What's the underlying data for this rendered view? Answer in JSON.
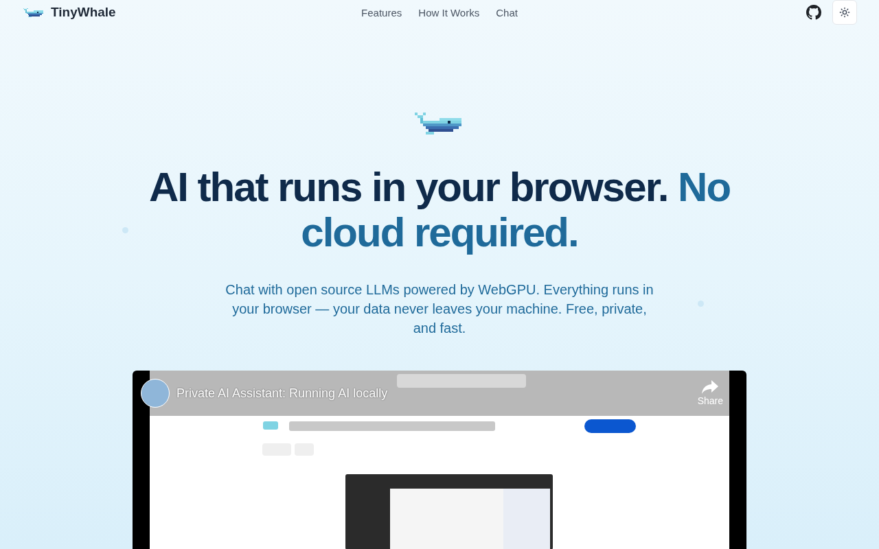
{
  "brand": {
    "name": "TinyWhale"
  },
  "nav": [
    "Features",
    "How It Works",
    "Chat"
  ],
  "hero": {
    "headline": "AI that runs in your browser.",
    "headline_accent": "No cloud required.",
    "subtitle": "Chat with open source LLMs powered by WebGPU. Everything runs in your browser — your data never leaves your machine. Free, private, and fast."
  },
  "video": {
    "title": "Private AI Assistant: Running AI locally",
    "share_label": "Share"
  }
}
